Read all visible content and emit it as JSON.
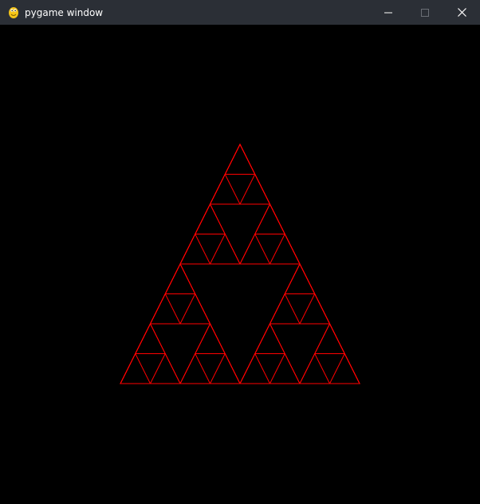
{
  "window": {
    "title": "pygame window",
    "app_icon": "pygame-snake-icon",
    "controls": [
      "minimize-icon",
      "maximize-icon",
      "close-icon"
    ]
  },
  "canvas": {
    "background_color": "#000000"
  },
  "fractal": {
    "name": "",
    "depth": 3,
    "stroke_color": "#ff0000"
  }
}
